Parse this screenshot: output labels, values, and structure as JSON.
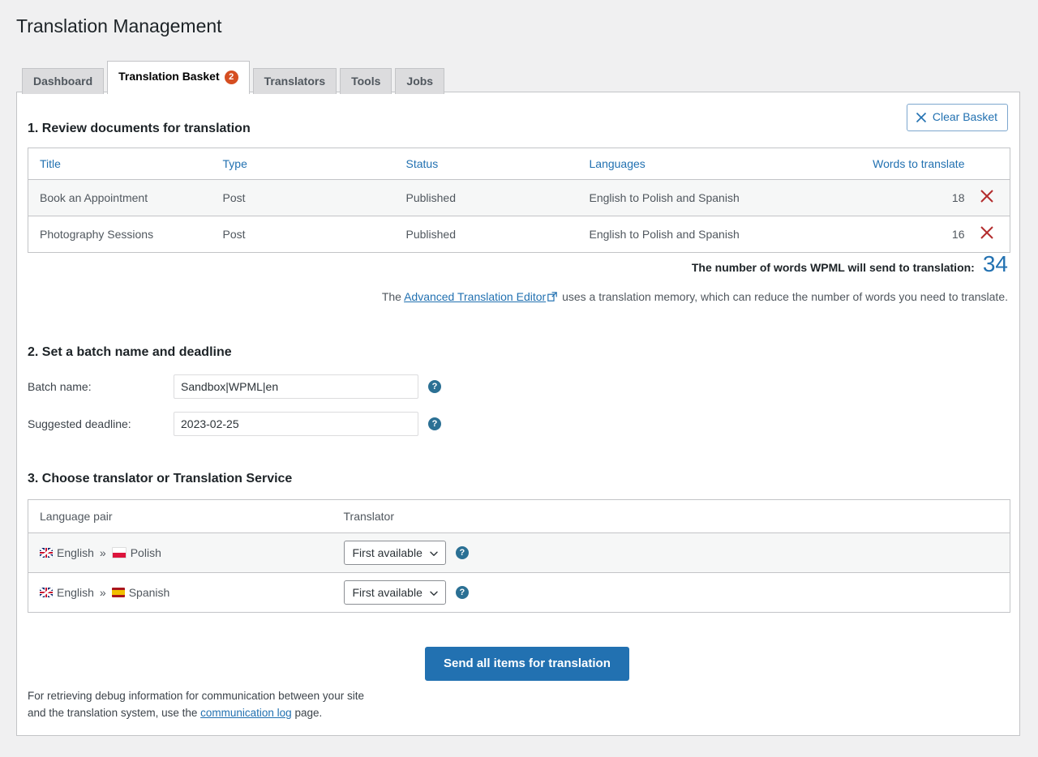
{
  "page": {
    "title": "Translation Management"
  },
  "tabs": [
    {
      "label": "Dashboard",
      "active": false,
      "badge": null
    },
    {
      "label": "Translation Basket",
      "active": true,
      "badge": "2"
    },
    {
      "label": "Translators",
      "active": false,
      "badge": null
    },
    {
      "label": "Tools",
      "active": false,
      "badge": null
    },
    {
      "label": "Jobs",
      "active": false,
      "badge": null
    }
  ],
  "toolbar": {
    "clear_basket_label": "Clear Basket",
    "clear_basket_icon": "close-x-icon"
  },
  "section1": {
    "title": "1. Review documents for translation",
    "columns": [
      "Title",
      "Type",
      "Status",
      "Languages",
      "Words to translate"
    ],
    "rows": [
      {
        "title": "Book an Appointment",
        "type": "Post",
        "status": "Published",
        "languages": "English to Polish and Spanish",
        "words": "18",
        "delete_icon": "remove-x-icon"
      },
      {
        "title": "Photography Sessions",
        "type": "Post",
        "status": "Published",
        "languages": "English to Polish and Spanish",
        "words": "16",
        "delete_icon": "remove-x-icon"
      }
    ],
    "words_total_label": "The number of words WPML will send to translation:",
    "words_total": "34",
    "ate_prefix": "The ",
    "ate_link": "Advanced Translation Editor",
    "ate_link_icon": "external-link-icon",
    "ate_suffix": " uses a translation memory, which can reduce the number of words you need to translate."
  },
  "section2": {
    "title": "2. Set a batch name and deadline",
    "batch_name_label": "Batch name:",
    "batch_name_value": "Sandbox|WPML|en",
    "batch_name_placeholder": "",
    "batch_name_help": "?",
    "deadline_label": "Suggested deadline:",
    "deadline_value": "2023-02-25",
    "deadline_placeholder": "",
    "deadline_help": "?"
  },
  "section3": {
    "title": "3. Choose translator or Translation Service",
    "columns": [
      "Language pair",
      "Translator"
    ],
    "rows": [
      {
        "source_flag": "flag-united-kingdom-icon",
        "source": "English",
        "arrow": "»",
        "target_flag": "flag-poland-icon",
        "target": "Polish",
        "translator_value": "First available",
        "translator_options": [
          "First available"
        ],
        "help": "?"
      },
      {
        "source_flag": "flag-united-kingdom-icon",
        "source": "English",
        "arrow": "»",
        "target_flag": "flag-spain-icon",
        "target": "Spanish",
        "translator_value": "First available",
        "translator_options": [
          "First available"
        ],
        "help": "?"
      }
    ]
  },
  "footer": {
    "send_button": "Send all items for translation",
    "debug_prefix": "For retrieving debug information for communication between your site and the translation system, use the ",
    "debug_link": "communication log",
    "debug_suffix": " page."
  },
  "colors": {
    "accent_blue": "#2271b1",
    "badge_orange": "#d54e21",
    "delete_red": "#b32d2e",
    "help_blue": "#2b7094",
    "page_bg": "#f0f0f1",
    "row_stripe": "#f6f7f7",
    "border": "#c3c4c7"
  }
}
